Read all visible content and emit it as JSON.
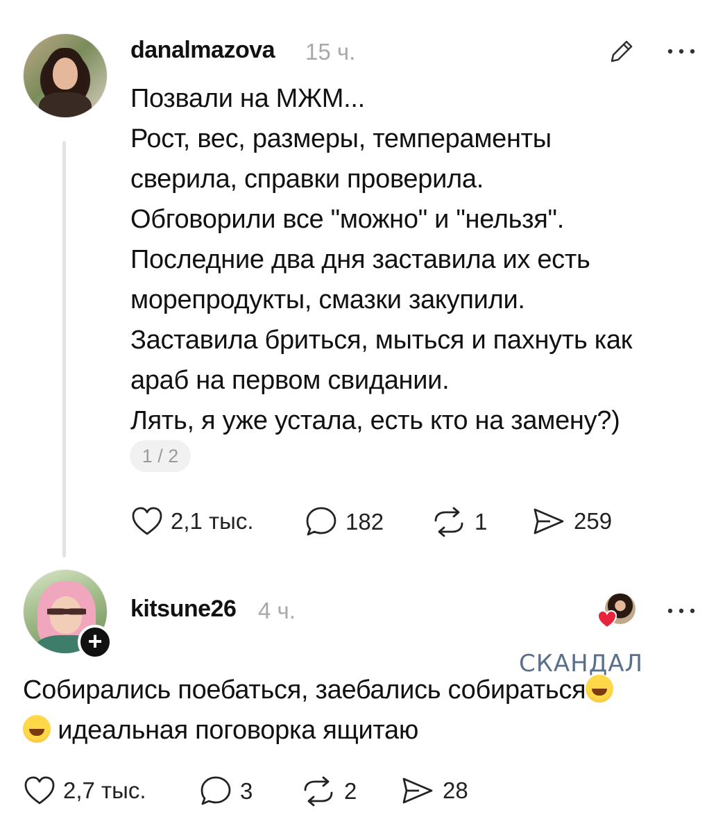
{
  "post": {
    "username": "danalmazova",
    "time": "15 ч.",
    "lines": [
      "Позвали на МЖМ...",
      "Рост, вес, размеры, темпераменты",
      "сверила, справки проверила.",
      "Обговорили все \"можно\" и \"нельзя\".",
      "Последние два дня заставила их есть",
      "морепродукты, смазки закупили.",
      "Заставила бриться, мыться и пахнуть как",
      "араб на первом свидании.",
      "Лять, я уже устала, есть кто на замену?)"
    ],
    "page_indicator": "1 / 2",
    "likes": "2,1 тыс.",
    "comments": "182",
    "reposts": "1",
    "shares": "259",
    "icons": [
      "edit-icon",
      "more-icon",
      "heart-icon",
      "comment-icon",
      "repost-icon",
      "share-icon"
    ]
  },
  "comment": {
    "username": "kitsune26",
    "time": "4 ч.",
    "line1": "Собирались поебаться, заебались собираться",
    "line2": "идеальная поговорка ящитаю",
    "likes": "2,7 тыс.",
    "comments": "3",
    "reposts": "2",
    "shares": "28",
    "follow_badge": "+",
    "icons": [
      "plus-icon",
      "liked-by-author-icon",
      "more-icon",
      "laughing-emoji",
      "rofl-emoji"
    ]
  },
  "watermark": "СКАНДАЛ"
}
